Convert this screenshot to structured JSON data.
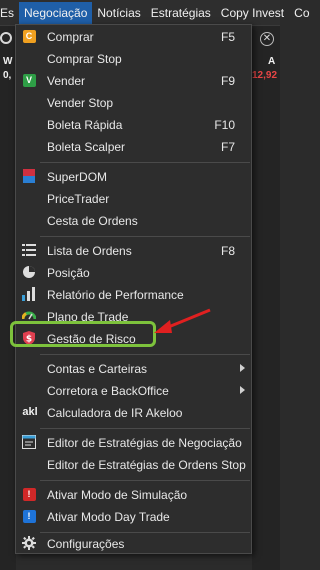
{
  "menubar": {
    "items": [
      "Es",
      "Negociação",
      "Notícias",
      "Estratégias",
      "Copy Invest",
      "Co"
    ],
    "active_index": 1
  },
  "background": {
    "left_ticker": "W",
    "left_value": "0,",
    "right_ticker": "A",
    "right_value": "12,92"
  },
  "menu": {
    "comprar": {
      "label": "Comprar",
      "shortcut": "F5",
      "icon": "C"
    },
    "comprar_stop": {
      "label": "Comprar Stop"
    },
    "vender": {
      "label": "Vender",
      "shortcut": "F9",
      "icon": "V"
    },
    "vender_stop": {
      "label": "Vender Stop"
    },
    "boleta_rapida": {
      "label": "Boleta Rápida",
      "shortcut": "F10"
    },
    "boleta_scalper": {
      "label": "Boleta Scalper",
      "shortcut": "F7"
    },
    "superdom": {
      "label": "SuperDOM"
    },
    "pricetrader": {
      "label": "PriceTrader"
    },
    "cesta": {
      "label": "Cesta de Ordens"
    },
    "lista_ordens": {
      "label": "Lista de Ordens",
      "shortcut": "F8"
    },
    "posicao": {
      "label": "Posição"
    },
    "relatorio": {
      "label": "Relatório de Performance"
    },
    "plano": {
      "label": "Plano de Trade"
    },
    "gestao_risco": {
      "label": "Gestão de Risco"
    },
    "contas": {
      "label": "Contas e Carteiras"
    },
    "corretora": {
      "label": "Corretora e BackOffice"
    },
    "calculadora": {
      "label": "Calculadora de IR Akeloo",
      "icon": "akl"
    },
    "editor_estrategias": {
      "label": "Editor de Estratégias de Negociação"
    },
    "editor_stop": {
      "label": "Editor de Estratégias de Ordens Stop"
    },
    "modo_simulacao": {
      "label": "Ativar Modo de Simulação",
      "icon": "!"
    },
    "modo_daytrade": {
      "label": "Ativar Modo Day Trade",
      "icon": "!"
    },
    "configuracoes": {
      "label": "Configurações"
    }
  },
  "colors": {
    "menu_active": "#1f5fa8",
    "comprar_icon": "#f0a020",
    "vender_icon": "#2e9e46",
    "simulacao_icon": "#d02828",
    "daytrade_icon": "#1e73d8",
    "highlight_border": "#7dc23c",
    "annotation_arrow": "#e02020"
  }
}
